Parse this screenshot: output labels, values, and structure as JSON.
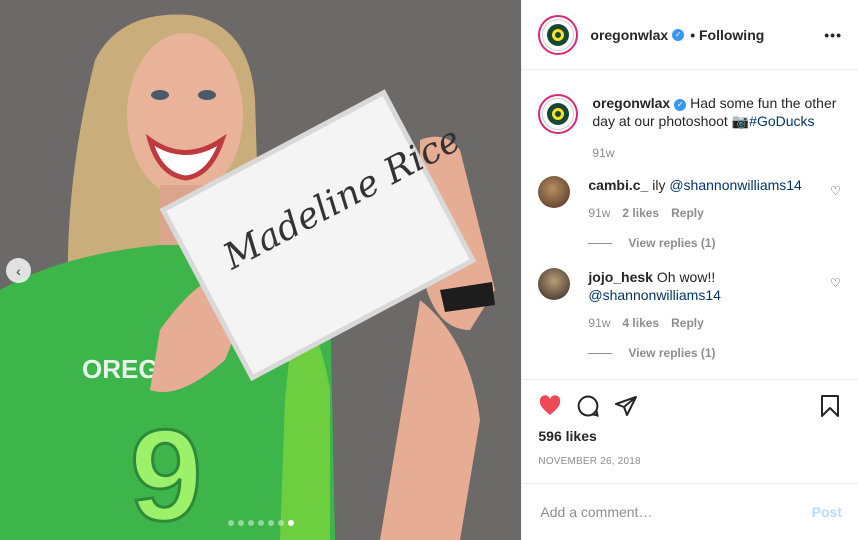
{
  "colors": {
    "brand_green": "#154733",
    "brand_yellow": "#fee123",
    "link": "#003569",
    "like_red": "#ed4956",
    "post_disabled": "#b2dffc"
  },
  "media": {
    "jersey_text": "OREGON",
    "jersey_number": "9",
    "sign_text": "Madeline Rice",
    "prev_icon": "chevron-left-icon",
    "carousel_total": 7,
    "carousel_active": 7
  },
  "header": {
    "username": "oregonwlax",
    "verified_icon": "verified-badge-icon",
    "separator": "•",
    "following": "Following",
    "more_icon": "more-horizontal-icon"
  },
  "caption": {
    "username": "oregonwlax",
    "text": "Had some fun the other day at our photoshoot 📷",
    "hashtag": "#GoDucks",
    "time": "91w"
  },
  "comments": [
    {
      "username": "cambi.c_",
      "text": "ily",
      "mention": "@shannonwilliams14",
      "time": "91w",
      "likes": "2 likes",
      "reply": "Reply",
      "view_replies": "View replies (1)"
    },
    {
      "username": "jojo_hesk",
      "text": "Oh wow!!",
      "mention": "@shannonwilliams14",
      "time": "91w",
      "likes": "4 likes",
      "reply": "Reply",
      "view_replies": "View replies (1)"
    }
  ],
  "actions": {
    "likes": "596 likes",
    "date": "NOVEMBER 26, 2018",
    "like_icon": "heart-filled-icon",
    "comment_icon": "comment-icon",
    "share_icon": "share-icon",
    "save_icon": "bookmark-icon"
  },
  "add_comment": {
    "placeholder": "Add a comment…",
    "post": "Post"
  }
}
